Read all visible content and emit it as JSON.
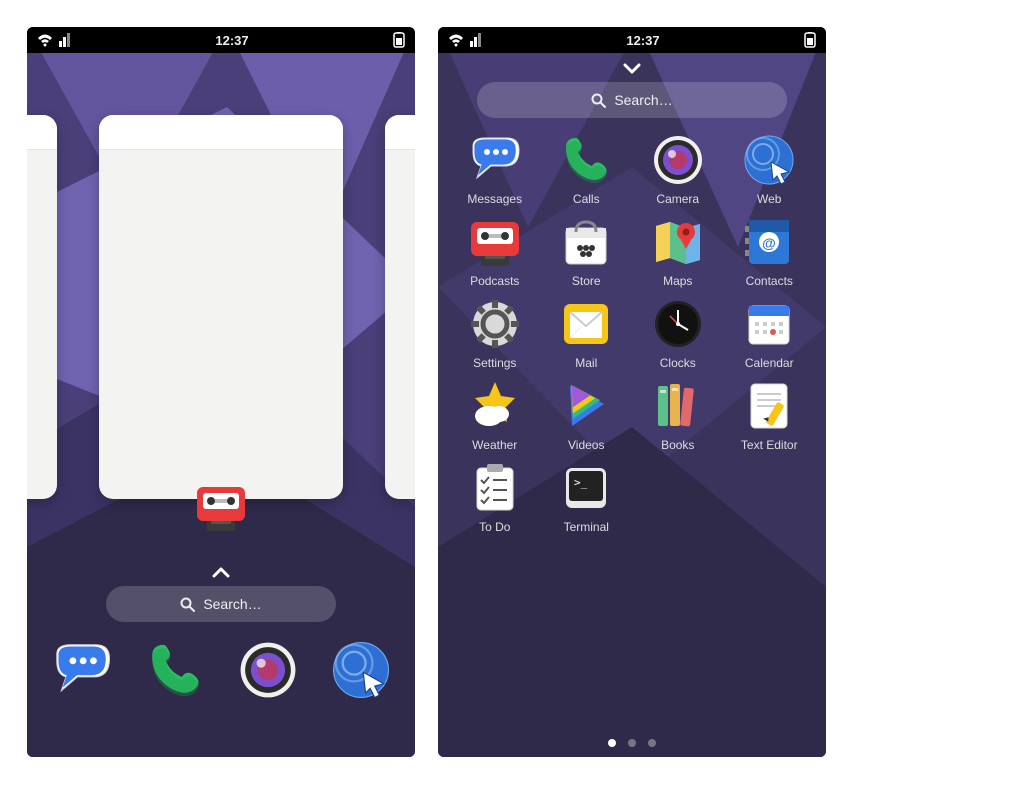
{
  "status": {
    "time": "12:37"
  },
  "search": {
    "placeholder": "Search…"
  },
  "overview": {
    "focused_app": "Podcasts"
  },
  "dock": [
    {
      "name": "Messages"
    },
    {
      "name": "Calls"
    },
    {
      "name": "Camera"
    },
    {
      "name": "Web"
    }
  ],
  "apps": [
    {
      "name": "Messages"
    },
    {
      "name": "Calls"
    },
    {
      "name": "Camera"
    },
    {
      "name": "Web"
    },
    {
      "name": "Podcasts"
    },
    {
      "name": "Store"
    },
    {
      "name": "Maps"
    },
    {
      "name": "Contacts"
    },
    {
      "name": "Settings"
    },
    {
      "name": "Mail"
    },
    {
      "name": "Clocks"
    },
    {
      "name": "Calendar"
    },
    {
      "name": "Weather"
    },
    {
      "name": "Videos"
    },
    {
      "name": "Books"
    },
    {
      "name": "Text Editor"
    },
    {
      "name": "To Do"
    },
    {
      "name": "Terminal"
    }
  ],
  "pager": {
    "count": 3,
    "active": 0
  }
}
